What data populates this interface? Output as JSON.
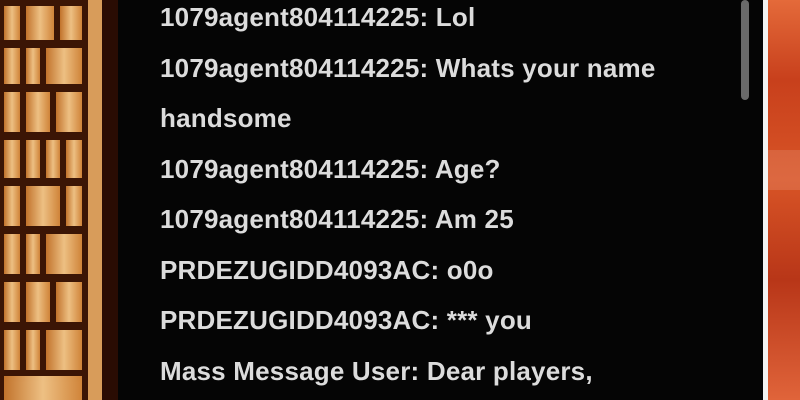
{
  "chat": {
    "messages": [
      {
        "sender": "1079agent804114225:",
        "text": "Lol"
      },
      {
        "sender": "1079agent804114225:",
        "text": "Whats your name handsome"
      },
      {
        "sender": "1079agent804114225:",
        "text": "Age?"
      },
      {
        "sender": "1079agent804114225:",
        "text": "Am 25"
      },
      {
        "sender": "PRDEZUGIDD4093AC:",
        "text": "o0o"
      },
      {
        "sender": "PRDEZUGIDD4093AC:",
        "text": "*** you"
      },
      {
        "sender": "Mass Message User:",
        "text": "Dear players,"
      }
    ]
  },
  "colors": {
    "chat_background": "#050505",
    "chat_text": "#dcdcdc",
    "scrollbar": "#6a6a6a",
    "window_glow": "#f5c27a"
  }
}
